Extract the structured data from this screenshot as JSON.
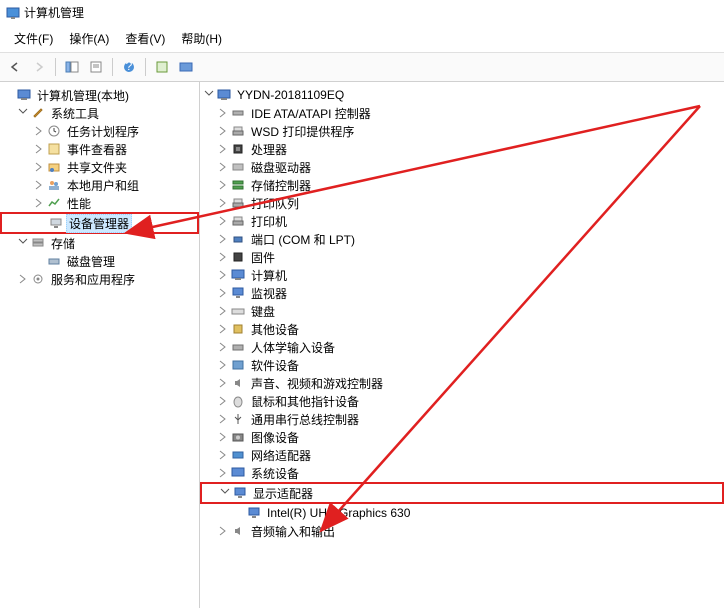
{
  "window": {
    "title": "计算机管理"
  },
  "menubar": {
    "file": "文件(F)",
    "action": "操作(A)",
    "view": "查看(V)",
    "help": "帮助(H)"
  },
  "left_tree": {
    "root": "计算机管理(本地)",
    "system_tools": "系统工具",
    "task_scheduler": "任务计划程序",
    "event_viewer": "事件查看器",
    "shared_folders": "共享文件夹",
    "local_users": "本地用户和组",
    "performance": "性能",
    "device_manager": "设备管理器",
    "storage": "存储",
    "disk_management": "磁盘管理",
    "services": "服务和应用程序"
  },
  "right_tree": {
    "computer": "YYDN-20181109EQ",
    "ide": "IDE ATA/ATAPI 控制器",
    "wsd": "WSD 打印提供程序",
    "cpu": "处理器",
    "disk_drives": "磁盘驱动器",
    "storage_ctrl": "存储控制器",
    "print_queue": "打印队列",
    "printer": "打印机",
    "ports": "端口 (COM 和 LPT)",
    "firmware": "固件",
    "computers": "计算机",
    "monitors": "监视器",
    "keyboard": "键盘",
    "other": "其他设备",
    "hid": "人体学输入设备",
    "software": "软件设备",
    "sound": "声音、视频和游戏控制器",
    "mouse": "鼠标和其他指针设备",
    "usb": "通用串行总线控制器",
    "imaging": "图像设备",
    "network": "网络适配器",
    "system_dev": "系统设备",
    "display": "显示适配器",
    "display_child": "Intel(R) UHD Graphics 630",
    "audio_io": "音频输入和输出"
  }
}
